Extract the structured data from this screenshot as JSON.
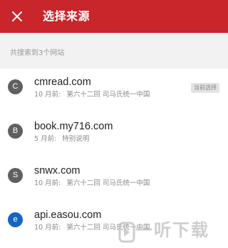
{
  "header": {
    "title": "选择来源",
    "close_icon": "close-icon",
    "background": "#c8262a"
  },
  "subheader": {
    "text": "共搜索到3个网站"
  },
  "sources": [
    {
      "avatar": "C",
      "domain": "cmread.com",
      "time": "10 月前:",
      "chapter": "第六十二回 司马氏统一中国",
      "badge": "当前选择"
    },
    {
      "avatar": "B",
      "domain": "book.my716.com",
      "time": "5 月前:",
      "chapter": "特别说明",
      "badge": ""
    },
    {
      "avatar": "S",
      "domain": "snwx.com",
      "time": "10 月前:",
      "chapter": "第六十二回 司马氏统一中国",
      "badge": ""
    },
    {
      "avatar": "e",
      "domain": "api.easou.com",
      "time": "10 月前:",
      "chapter": "第六十二回 司马氏统一中国",
      "badge": ""
    }
  ],
  "watermark": {
    "text": "一听下载"
  }
}
